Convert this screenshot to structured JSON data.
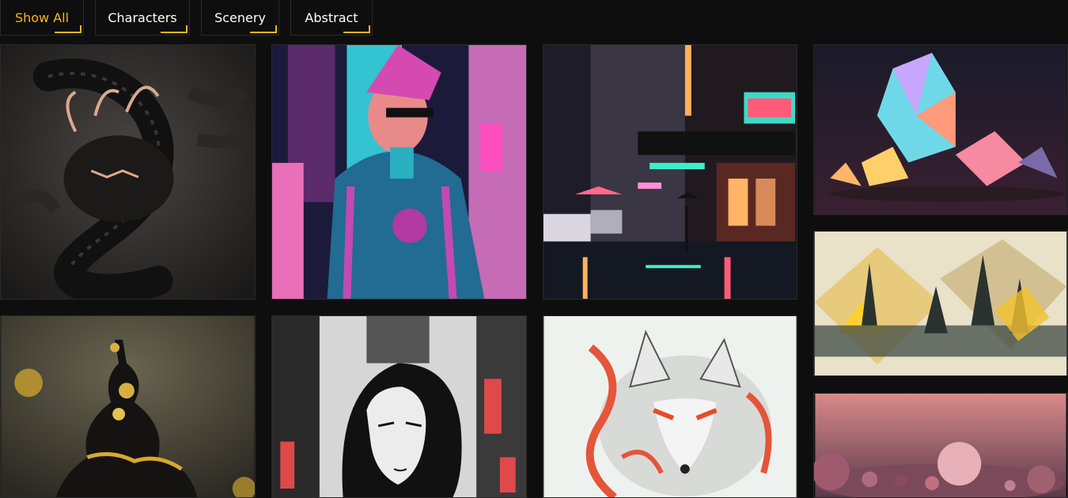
{
  "filters": [
    {
      "label": "Show All",
      "active": true
    },
    {
      "label": "Characters",
      "active": false
    },
    {
      "label": "Scenery",
      "active": false
    },
    {
      "label": "Abstract",
      "active": false
    }
  ],
  "colors": {
    "accent": "#f5b71a",
    "background": "#0e0e0e"
  },
  "gallery": [
    {
      "subject": "black paper dragon"
    },
    {
      "subject": "cyberpunk man in neon city"
    },
    {
      "subject": "pixel art rainy street"
    },
    {
      "subject": "iridescent crystals"
    },
    {
      "subject": "gold ink abstract cathedral"
    },
    {
      "subject": "black and gold sculpture"
    },
    {
      "subject": "manga girl in city"
    },
    {
      "subject": "white fox with red swirls"
    },
    {
      "subject": "pink spheres macro"
    }
  ]
}
